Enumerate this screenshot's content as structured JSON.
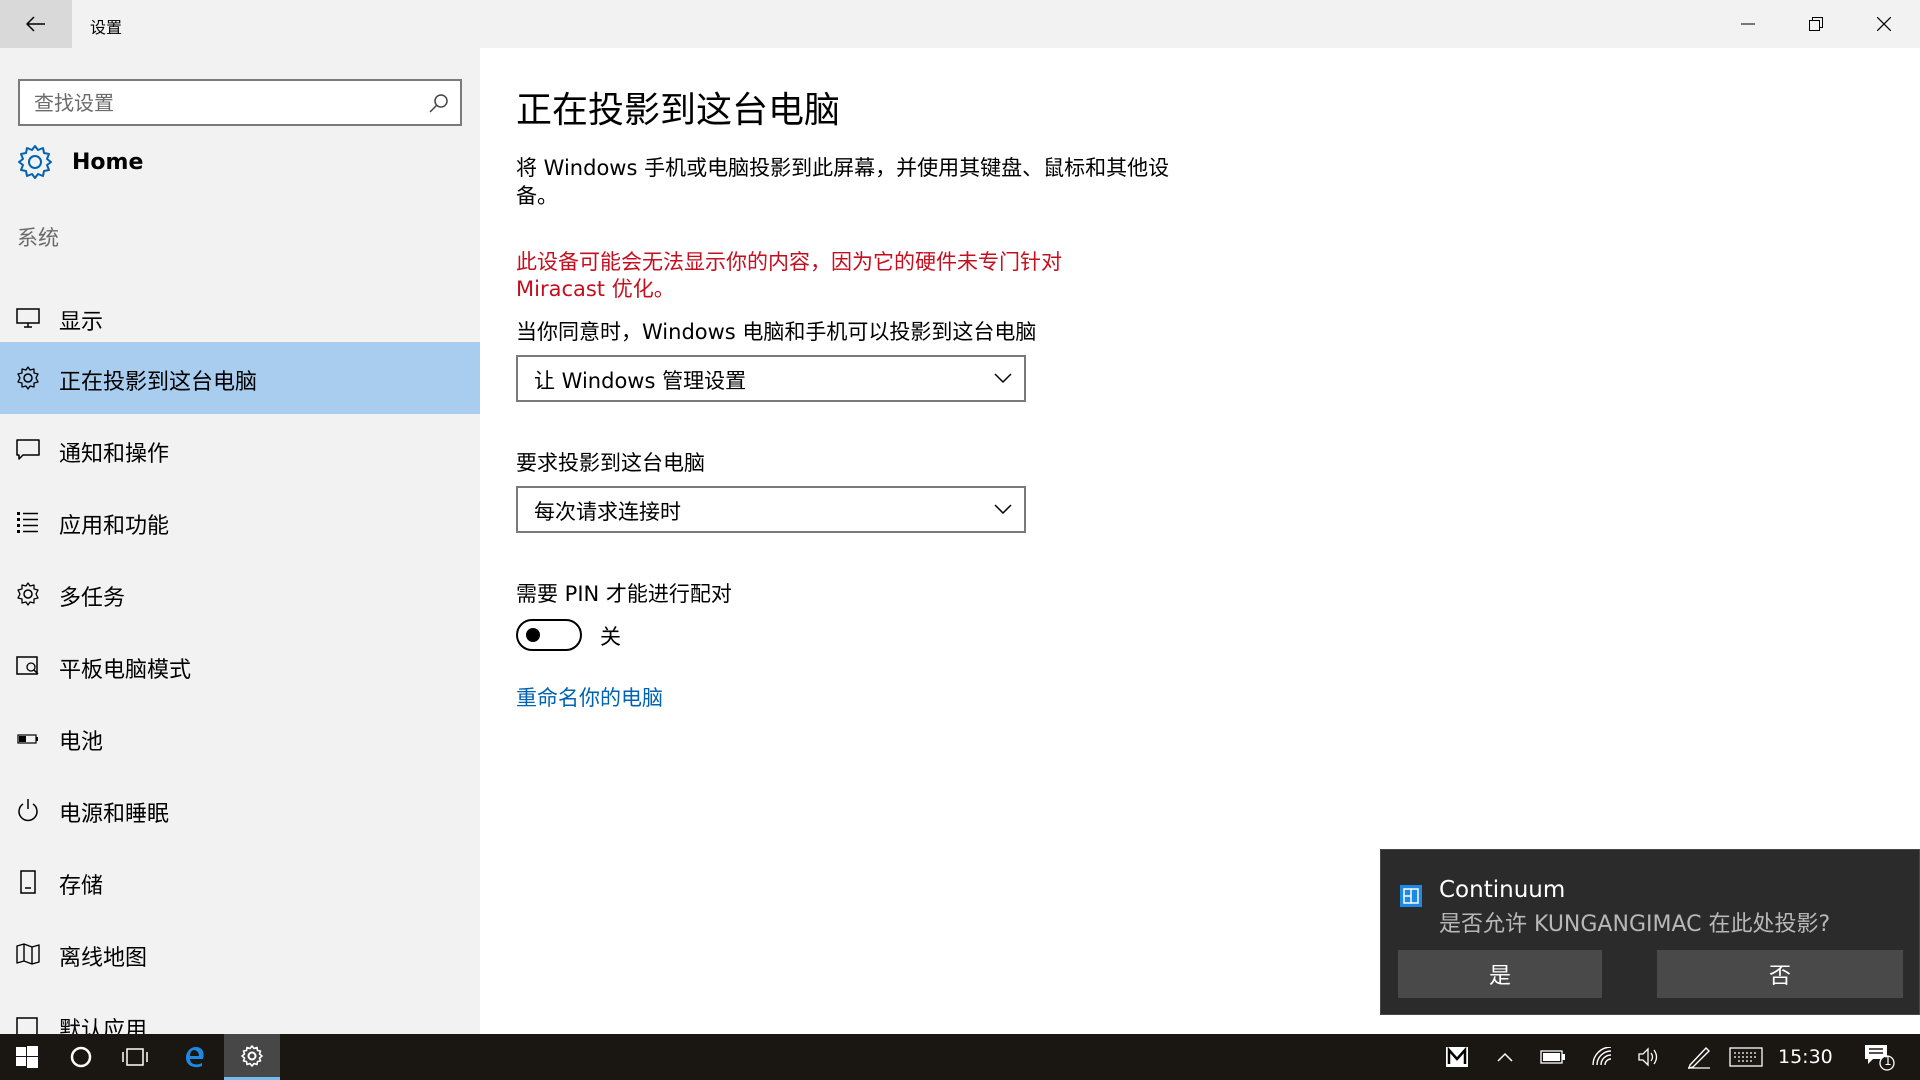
{
  "window": {
    "title": "设置"
  },
  "sidebar": {
    "search_placeholder": "查找设置",
    "home_label": "Home",
    "group_label": "系统",
    "items": [
      {
        "label": "显示",
        "icon": "monitor-icon"
      },
      {
        "label": "正在投影到这台电脑",
        "icon": "project-icon",
        "active": true
      },
      {
        "label": "通知和操作",
        "icon": "notification-icon"
      },
      {
        "label": "应用和功能",
        "icon": "apps-list-icon"
      },
      {
        "label": "多任务",
        "icon": "multitask-icon"
      },
      {
        "label": "平板电脑模式",
        "icon": "tablet-icon"
      },
      {
        "label": "电池",
        "icon": "battery-icon"
      },
      {
        "label": "电源和睡眠",
        "icon": "power-icon"
      },
      {
        "label": "存储",
        "icon": "storage-icon"
      },
      {
        "label": "离线地图",
        "icon": "map-icon"
      },
      {
        "label": "默认应用",
        "icon": "default-apps-icon"
      }
    ]
  },
  "main": {
    "title": "正在投影到这台电脑",
    "description": "将 Windows 手机或电脑投影到此屏幕，并使用其键盘、鼠标和其他设备。",
    "warning": "此设备可能会无法显示你的内容，因为它的硬件未专门针对 Miracast 优化。",
    "consent_label": "当你同意时，Windows 电脑和手机可以投影到这台电脑",
    "consent_value": "让 Windows 管理设置",
    "ask_label": "要求投影到这台电脑",
    "ask_value": "每次请求连接时",
    "pin_label": "需要 PIN 才能进行配对",
    "pin_state": "关",
    "rename_link": "重命名你的电脑"
  },
  "toast": {
    "title": "Continuum",
    "message": "是否允许 KUNGANGIMAC 在此处投影?",
    "yes_label": "是",
    "no_label": "否"
  },
  "taskbar": {
    "clock": "15:30",
    "notification_count": "1"
  },
  "colors": {
    "accent": "#0063b1",
    "active_item": "#a8cdef",
    "warning": "#c50f1f"
  }
}
